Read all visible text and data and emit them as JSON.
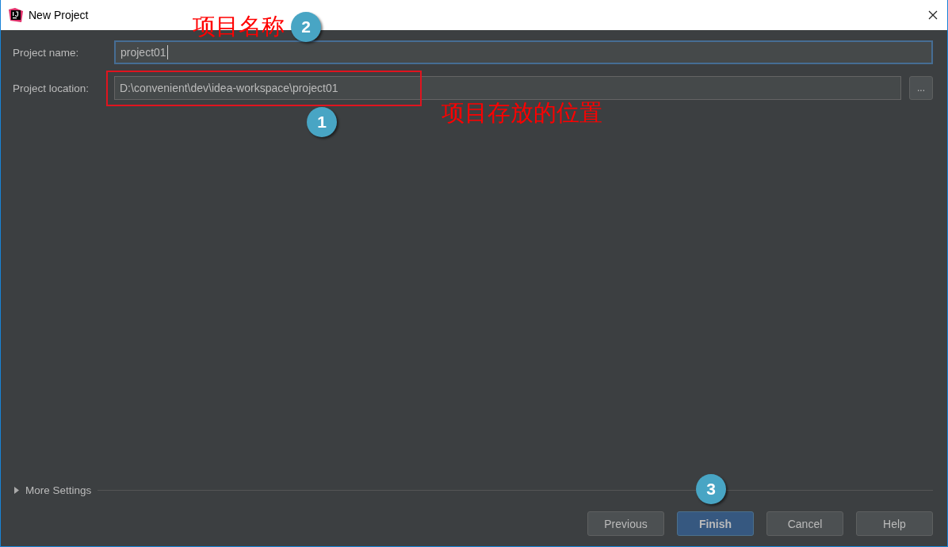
{
  "window": {
    "title": "New Project"
  },
  "fields": [
    {
      "label": "Project name:",
      "value": "project01",
      "focused": true
    },
    {
      "label": "Project location:",
      "value": "D:\\convenient\\dev\\idea-workspace\\project01",
      "focused": false,
      "browse": "..."
    }
  ],
  "more_settings": {
    "label": "More Settings",
    "expanded": false
  },
  "buttons": [
    {
      "label": "Previous",
      "default": false
    },
    {
      "label": "Finish",
      "default": true
    },
    {
      "label": "Cancel",
      "default": false
    },
    {
      "label": "Help",
      "default": false
    }
  ],
  "annotations": [
    {
      "kind": "text",
      "text": "项目名称"
    },
    {
      "kind": "badge",
      "text": "2"
    },
    {
      "kind": "box"
    },
    {
      "kind": "badge",
      "text": "1"
    },
    {
      "kind": "text",
      "text": "项目存放的位置"
    },
    {
      "kind": "badge",
      "text": "3"
    }
  ]
}
